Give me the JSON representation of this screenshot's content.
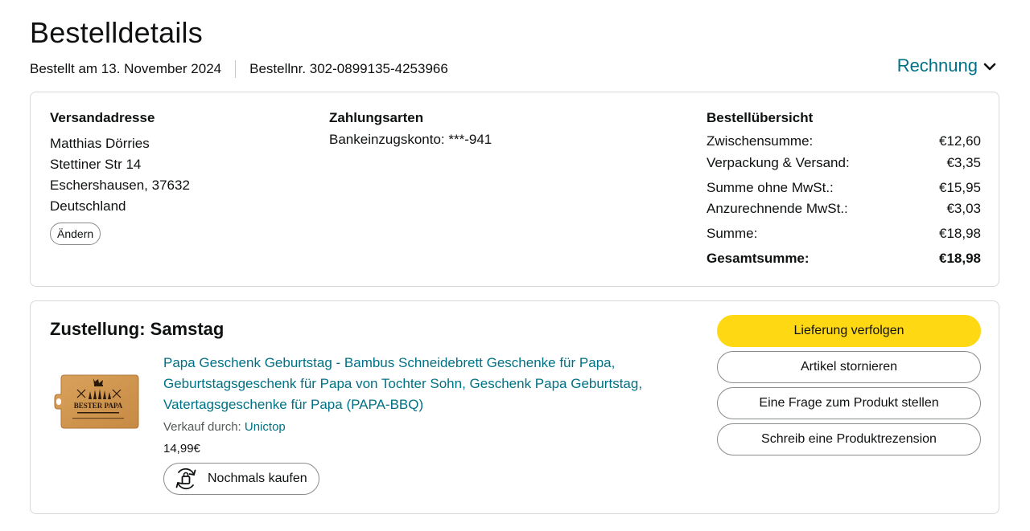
{
  "header": {
    "title": "Bestelldetails",
    "ordered_on": "Bestellt am 13. November 2024",
    "order_number": "Bestellnr. 302-0899135-4253966",
    "invoice_label": "Rechnung"
  },
  "shipping": {
    "heading": "Versandadresse",
    "lines": [
      "Matthias Dörries",
      "Stettiner Str 14",
      "Eschershausen, 37632",
      "Deutschland"
    ],
    "change_label": "Ändern"
  },
  "payment": {
    "heading": "Zahlungsarten",
    "method": "Bankeinzugskonto: ***-941"
  },
  "summary": {
    "heading": "Bestellübersicht",
    "rows": [
      {
        "label": "Zwischensumme:",
        "value": "€12,60"
      },
      {
        "label": "Verpackung & Versand:",
        "value": "€3,35"
      },
      {
        "label": "Summe ohne MwSt.:",
        "value": "€15,95"
      },
      {
        "label": "Anzurechnende MwSt.:",
        "value": "€3,03"
      },
      {
        "label": "Summe:",
        "value": "€18,98"
      },
      {
        "label": "Gesamtsumme:",
        "value": "€18,98"
      }
    ]
  },
  "delivery": {
    "title": "Zustellung: Samstag",
    "product": {
      "title": "Papa Geschenk Geburtstag - Bambus Schneidebrett Geschenke für Papa, Geburtstagsgeschenk für Papa von Tochter Sohn, Geschenk Papa Geburtstag, Vatertagsgeschenke für Papa (PAPA-BBQ)",
      "seller_prefix": "Verkauf durch: ",
      "seller_name": "Unictop",
      "price": "14,99€",
      "image_text": "BESTER PAPA",
      "buy_again_label": "Nochmals kaufen"
    },
    "actions": {
      "track": "Lieferung verfolgen",
      "cancel": "Artikel stornieren",
      "question": "Eine Frage zum Produkt stellen",
      "review": "Schreib eine Produktrezension"
    }
  },
  "colors": {
    "link": "#007185",
    "primary_button": "#ffd814",
    "border": "#d5d9d9",
    "text": "#0f1111"
  }
}
